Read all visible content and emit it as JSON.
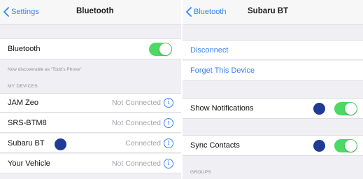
{
  "left_screen": {
    "back_label": "Settings",
    "title": "Bluetooth",
    "bluetooth_row": {
      "label": "Bluetooth",
      "toggle_on": true
    },
    "discoverable_note": "Now discoverable as “Todd’s Phone”",
    "my_devices_header": "MY DEVICES",
    "devices": [
      {
        "name": "JAM Zeo",
        "status": "Not Connected"
      },
      {
        "name": "SRS-BTM8",
        "status": "Not Connected"
      },
      {
        "name": "Subaru BT",
        "status": "Connected"
      },
      {
        "name": "Your Vehicle",
        "status": "Not Connected"
      }
    ],
    "info_glyph": "i"
  },
  "right_screen": {
    "back_label": "Bluetooth",
    "title": "Subaru BT",
    "disconnect_label": "Disconnect",
    "forget_label": "Forget This Device",
    "show_notifications": {
      "label": "Show Notifications",
      "toggle_on": true
    },
    "sync_contacts": {
      "label": "Sync Contacts",
      "toggle_on": true
    },
    "groups_header": "GROUPS"
  },
  "colors": {
    "accent": "#3a82f6",
    "toggle_on": "#4cd964",
    "marker": "#1f3c94",
    "background": "#efeff4"
  },
  "icons": {
    "back": "chevron-left-icon",
    "info": "info-circle-icon"
  }
}
